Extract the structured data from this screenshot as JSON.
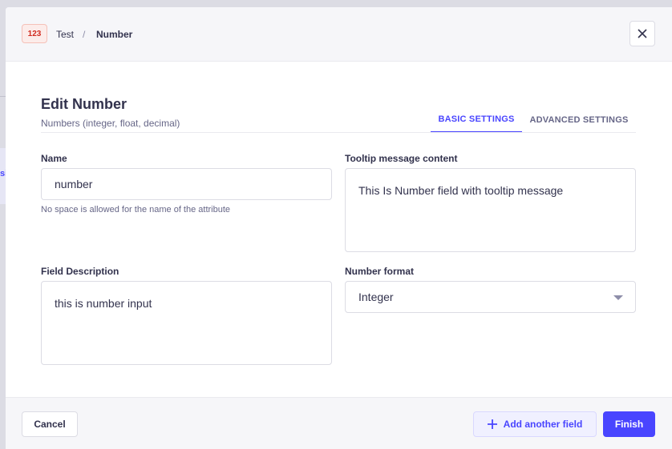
{
  "header": {
    "badge": "123",
    "breadcrumb": [
      "Test",
      "/",
      "Number"
    ]
  },
  "form": {
    "title": "Edit Number",
    "subtitle": "Numbers (integer, float, decimal)",
    "tabs": [
      "BASIC SETTINGS",
      "ADVANCED SETTINGS"
    ],
    "name": {
      "label": "Name",
      "value": "number",
      "hint": "No space is allowed for the name of the attribute"
    },
    "tooltip": {
      "label": "Tooltip message content",
      "value": "This Is Number field with tooltip message"
    },
    "description": {
      "label": "Field Description",
      "value": "this is number input"
    },
    "number_format": {
      "label": "Number format",
      "value": "Integer"
    }
  },
  "footer": {
    "cancel": "Cancel",
    "add_another": "Add another field",
    "finish": "Finish"
  },
  "background": {
    "strip_text": "si"
  },
  "colors": {
    "primary": "#4945ff",
    "badge_text": "#d02b20"
  }
}
